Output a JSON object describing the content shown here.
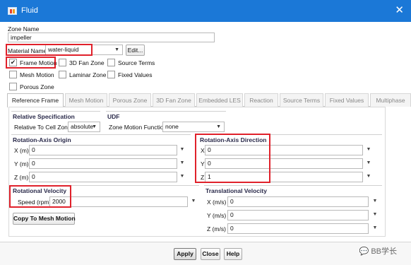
{
  "window": {
    "title": "Fluid",
    "close_glyph": "✕",
    "icon": "fluent-fluid-icon"
  },
  "zone": {
    "label": "Zone Name",
    "value": "impeller"
  },
  "material": {
    "label": "Material Name",
    "value": "water-liquid",
    "edit_label": "Edit..."
  },
  "options": [
    {
      "label": "Frame Motion",
      "checked": true
    },
    {
      "label": "3D Fan Zone",
      "checked": false
    },
    {
      "label": "Source Terms",
      "checked": false
    },
    {
      "label": "Mesh Motion",
      "checked": false
    },
    {
      "label": "Laminar Zone",
      "checked": false
    },
    {
      "label": "Fixed Values",
      "checked": false
    },
    {
      "label": "Porous Zone",
      "checked": false
    }
  ],
  "tabs": [
    "Reference Frame",
    "Mesh Motion",
    "Porous Zone",
    "3D Fan Zone",
    "Embedded LES",
    "Reaction",
    "Source Terms",
    "Fixed Values",
    "Multiphase"
  ],
  "reference_frame": {
    "relative_spec": {
      "title": "Relative Specification",
      "label": "Relative To Cell Zone",
      "value": "absolute"
    },
    "udf": {
      "title": "UDF",
      "label": "Zone Motion Function",
      "value": "none"
    },
    "axis_origin": {
      "title": "Rotation-Axis Origin",
      "fields": [
        {
          "label": "X (m)",
          "value": "0"
        },
        {
          "label": "Y (m)",
          "value": "0"
        },
        {
          "label": "Z (m)",
          "value": "0"
        }
      ]
    },
    "axis_direction": {
      "title": "Rotation-Axis Direction",
      "fields": [
        {
          "label": "X",
          "value": "0"
        },
        {
          "label": "Y",
          "value": "0"
        },
        {
          "label": "Z",
          "value": "1"
        }
      ]
    },
    "rotational_velocity": {
      "title": "Rotational Velocity",
      "label": "Speed (rpm)",
      "value": "2000"
    },
    "translational_velocity": {
      "title": "Translational Velocity",
      "fields": [
        {
          "label": "X (m/s)",
          "value": "0"
        },
        {
          "label": "Y (m/s)",
          "value": "0"
        },
        {
          "label": "Z (m/s)",
          "value": "0"
        }
      ]
    },
    "copy_button": "Copy To Mesh Motion"
  },
  "footer": {
    "apply": "Apply",
    "close": "Close",
    "help": "Help"
  },
  "watermark": "BB学长",
  "colors": {
    "titlebar": "#1b78d7",
    "highlight": "#e0212b"
  }
}
